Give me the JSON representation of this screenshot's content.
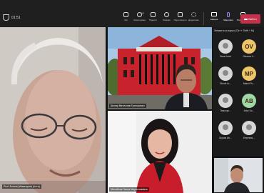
{
  "toolbar": {
    "timer": "01:51",
    "tools": [
      {
        "label": "Чат",
        "icon": "chat-icon"
      },
      {
        "label": "Користувачі",
        "icon": "people-icon"
      },
      {
        "label": "Підняти",
        "icon": "raise-hand-icon"
      },
      {
        "label": "Реакція",
        "icon": "reaction-icon"
      },
      {
        "label": "Переглянути",
        "icon": "view-icon"
      },
      {
        "label": "Додатково",
        "icon": "more-icon"
      }
    ],
    "participants_count": "12",
    "camera_label": "Камера",
    "mic_label": "Мікрофон",
    "share_label": "Поділитися",
    "leave_label": "Вийти"
  },
  "videos": {
    "main_name": "Prof. Andrzej Wawrzynek (гість)",
    "building_name": "Шкляр Вячеслав Григорович",
    "woman_name": "Михайлик Ганна Мирославівна"
  },
  "panel": {
    "title": "Знімається зараз (Ctrl + Shift + M)",
    "participants": [
      {
        "name": "Бюзе Інна",
        "initials": "",
        "color": "#d7d7d7",
        "photo": true
      },
      {
        "name": "Оксана Ч...",
        "initials": "OV",
        "color": "#efc56a",
        "photo": false
      },
      {
        "name": "Skorik Ін...",
        "initials": "",
        "color": "#d7d7d7",
        "photo": true
      },
      {
        "name": "Matvii Ро...",
        "initials": "MP",
        "color": "#efc56a",
        "photo": false
      },
      {
        "name": "Тимочко...",
        "initials": "",
        "color": "#d7d7d7",
        "photo": true
      },
      {
        "name": "Artur Бо...",
        "initials": "AB",
        "color": "#9fd7a6",
        "photo": false
      },
      {
        "name": "Шурик Ан...",
        "initials": "",
        "color": "#d7d7d7",
        "photo": true
      },
      {
        "name": "Березюк...",
        "initials": "",
        "color": "#d7d7d7",
        "photo": true
      }
    ]
  },
  "colors": {
    "leave": "#c4314b",
    "building_red": "#c8222c",
    "accent": "#9b8cff"
  }
}
